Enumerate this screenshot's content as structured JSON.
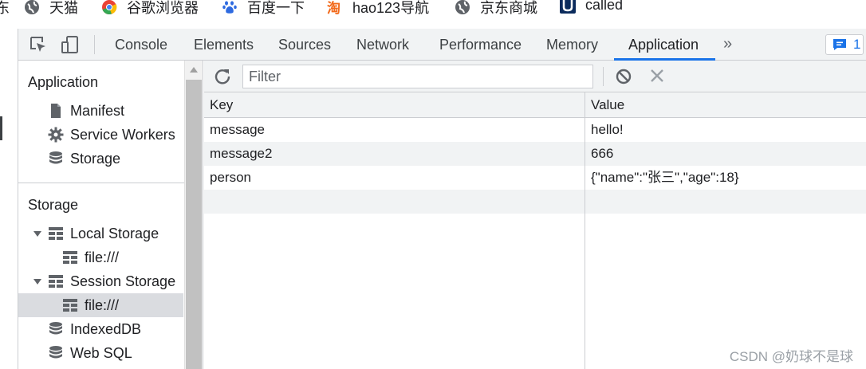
{
  "bookmarks": [
    {
      "label": "天猫",
      "icon": "globe-icon"
    },
    {
      "label": "谷歌浏览器",
      "icon": "chrome-icon"
    },
    {
      "label": "百度一下",
      "icon": "baidu-icon"
    },
    {
      "label": "hao123导航",
      "icon": "hao123-icon"
    },
    {
      "label": "京东商城",
      "icon": "globe-icon"
    },
    {
      "label": "called",
      "icon": "u-logo-icon"
    }
  ],
  "bookmark_fragment": "东",
  "toolbar": {
    "tabs": [
      "Console",
      "Elements",
      "Sources",
      "Network",
      "Performance",
      "Memory",
      "Application"
    ],
    "active_tab": "Application",
    "more": "»",
    "issues_count": "1"
  },
  "sidebar": {
    "application_header": "Application",
    "application_items": [
      {
        "label": "Manifest",
        "icon": "file-icon"
      },
      {
        "label": "Service Workers",
        "icon": "gear-icon"
      },
      {
        "label": "Storage",
        "icon": "database-icon"
      }
    ],
    "storage_header": "Storage",
    "storage_items": [
      {
        "label": "Local Storage",
        "icon": "table-icon",
        "expanded": true
      },
      {
        "label": "file:///",
        "icon": "table-icon"
      },
      {
        "label": "Session Storage",
        "icon": "table-icon",
        "expanded": true
      },
      {
        "label": "file:///",
        "icon": "table-icon",
        "selected": true
      },
      {
        "label": "IndexedDB",
        "icon": "database-icon"
      },
      {
        "label": "Web SQL",
        "icon": "database-icon"
      }
    ]
  },
  "filter": {
    "placeholder": "Filter"
  },
  "table": {
    "headers": [
      "Key",
      "Value"
    ],
    "rows": [
      [
        "message",
        "hello!"
      ],
      [
        "message2",
        "666"
      ],
      [
        "person",
        "{\"name\":\"张三\",\"age\":18}"
      ]
    ]
  },
  "watermark": "CSDN @奶球不是球",
  "colors": {
    "accent": "#1a73e8",
    "toolbar_bg": "#f1f3f4",
    "selected_bg": "#dadce0"
  }
}
